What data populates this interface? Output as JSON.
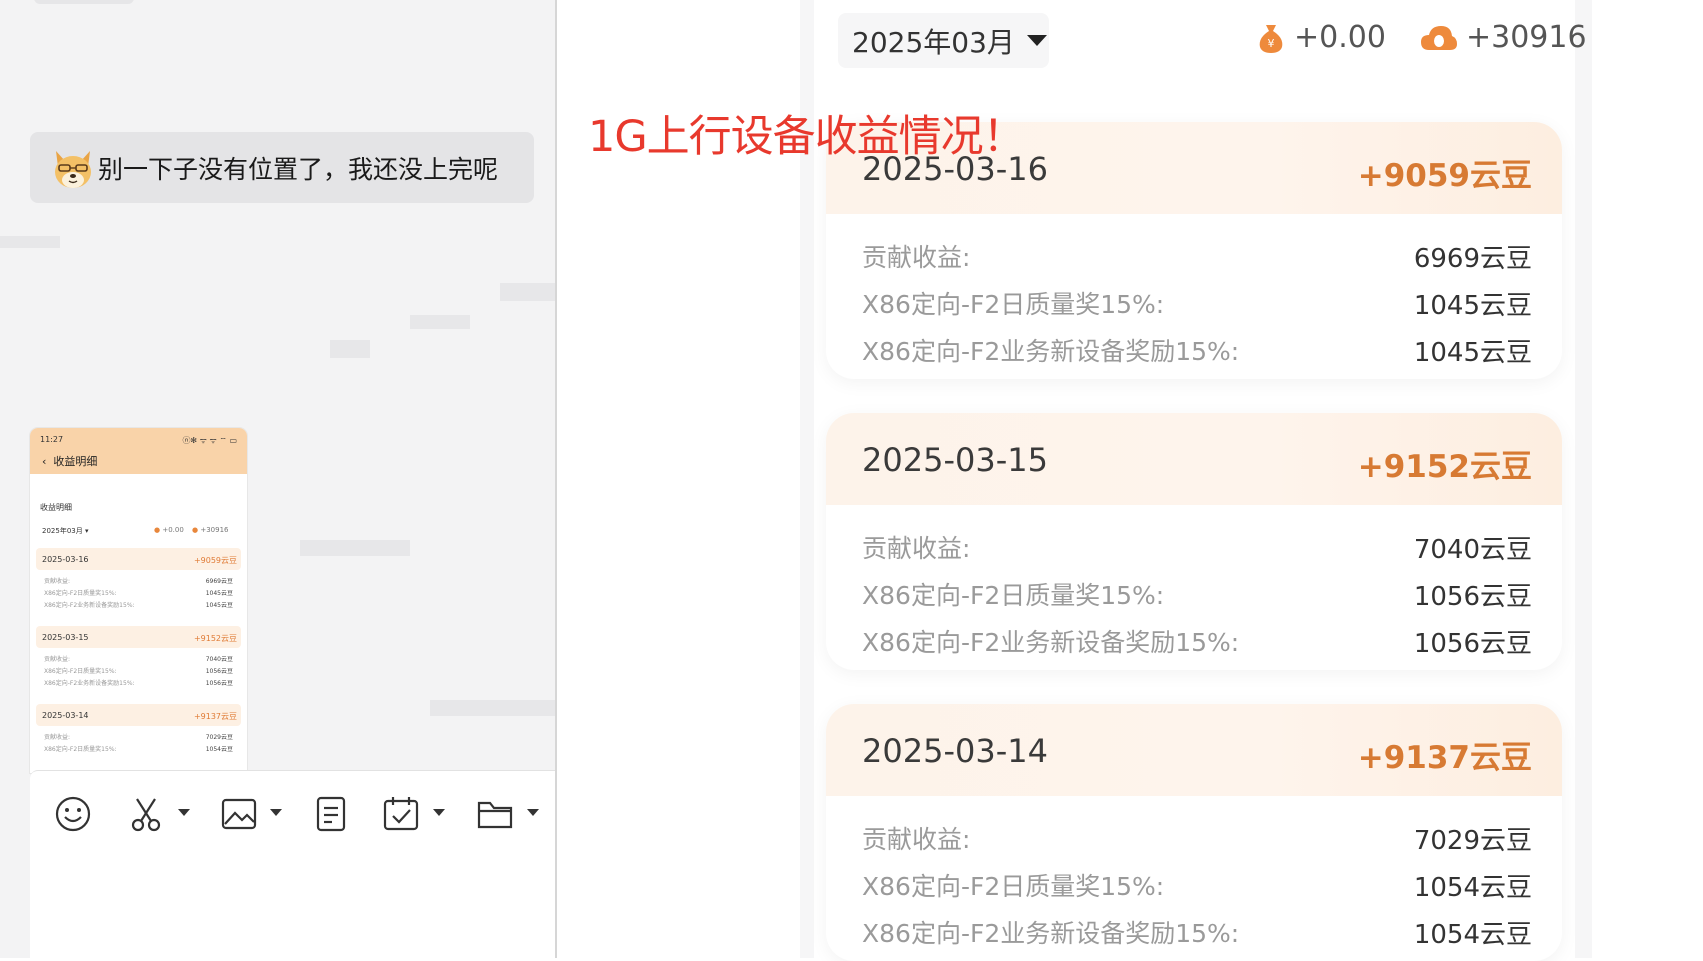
{
  "chat": {
    "message": "别一下子没有位置了，我还没上完呢"
  },
  "thumbnail": {
    "status_time": "11:27",
    "status_icons": "ⓝ✻ ᯤ ᯤ ⌔ ▭",
    "nav_title": "收益明细",
    "section_title": "收益明细",
    "month": "2025年03月 ▾",
    "stat_money": "+0.00",
    "stat_beans": "+30916",
    "days": [
      {
        "date": "2025-03-16",
        "total": "+9059云豆",
        "lines": [
          [
            "贡献收益:",
            "6969云豆"
          ],
          [
            "X86定向-F2日质量奖15%:",
            "1045云豆"
          ],
          [
            "X86定向-F2业务新设备奖励15%:",
            "1045云豆"
          ]
        ]
      },
      {
        "date": "2025-03-15",
        "total": "+9152云豆",
        "lines": [
          [
            "贡献收益:",
            "7040云豆"
          ],
          [
            "X86定向-F2日质量奖15%:",
            "1056云豆"
          ],
          [
            "X86定向-F2业务新设备奖励15%:",
            "1056云豆"
          ]
        ]
      },
      {
        "date": "2025-03-14",
        "total": "+9137云豆",
        "lines": [
          [
            "贡献收益:",
            "7029云豆"
          ],
          [
            "X86定向-F2日质量奖15%:",
            "1054云豆"
          ]
        ]
      }
    ]
  },
  "toolbar": {
    "icons": [
      "emoji-icon",
      "scissors-icon",
      "image-icon",
      "document-icon",
      "calendar-check-icon",
      "folder-icon"
    ]
  },
  "annotation": "1G上行设备收益情况！",
  "earnings": {
    "month": "2025年03月",
    "stat_money": "+0.00",
    "stat_beans": "+30916",
    "colors": {
      "accent": "#d77a33",
      "annotation": "#e8392d",
      "card_header": "#fdf3ea"
    },
    "days": [
      {
        "date": "2025-03-16",
        "total": "+9059云豆",
        "rows": [
          {
            "label": "贡献收益:",
            "value": "6969云豆"
          },
          {
            "label": "X86定向-F2日质量奖15%:",
            "value": "1045云豆"
          },
          {
            "label": "X86定向-F2业务新设备奖励15%:",
            "value": "1045云豆"
          }
        ]
      },
      {
        "date": "2025-03-15",
        "total": "+9152云豆",
        "rows": [
          {
            "label": "贡献收益:",
            "value": "7040云豆"
          },
          {
            "label": "X86定向-F2日质量奖15%:",
            "value": "1056云豆"
          },
          {
            "label": "X86定向-F2业务新设备奖励15%:",
            "value": "1056云豆"
          }
        ]
      },
      {
        "date": "2025-03-14",
        "total": "+9137云豆",
        "rows": [
          {
            "label": "贡献收益:",
            "value": "7029云豆"
          },
          {
            "label": "X86定向-F2日质量奖15%:",
            "value": "1054云豆"
          },
          {
            "label": "X86定向-F2业务新设备奖励15%:",
            "value": "1054云豆"
          }
        ]
      }
    ]
  }
}
